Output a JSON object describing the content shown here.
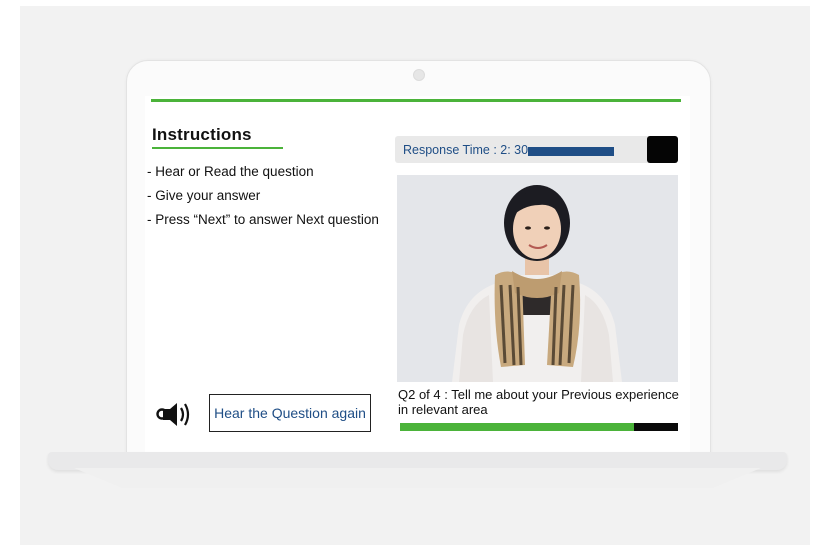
{
  "instructions": {
    "title": "Instructions",
    "items": [
      "- Hear or Read the question",
      "- Give your answer",
      "- Press “Next” to answer Next question"
    ]
  },
  "response": {
    "label": "Response Time : 2: 30",
    "bar_color": "#1f4e86"
  },
  "question": {
    "text": "Q2 of 4 : Tell me about your Previous experience in relevant area",
    "progress_fraction": 0.84
  },
  "controls": {
    "hear_again_label": "Hear the Question again",
    "speaker_icon": "speaker-icon"
  },
  "colors": {
    "accent_green": "#4bb33a",
    "accent_blue": "#1f4e86"
  }
}
